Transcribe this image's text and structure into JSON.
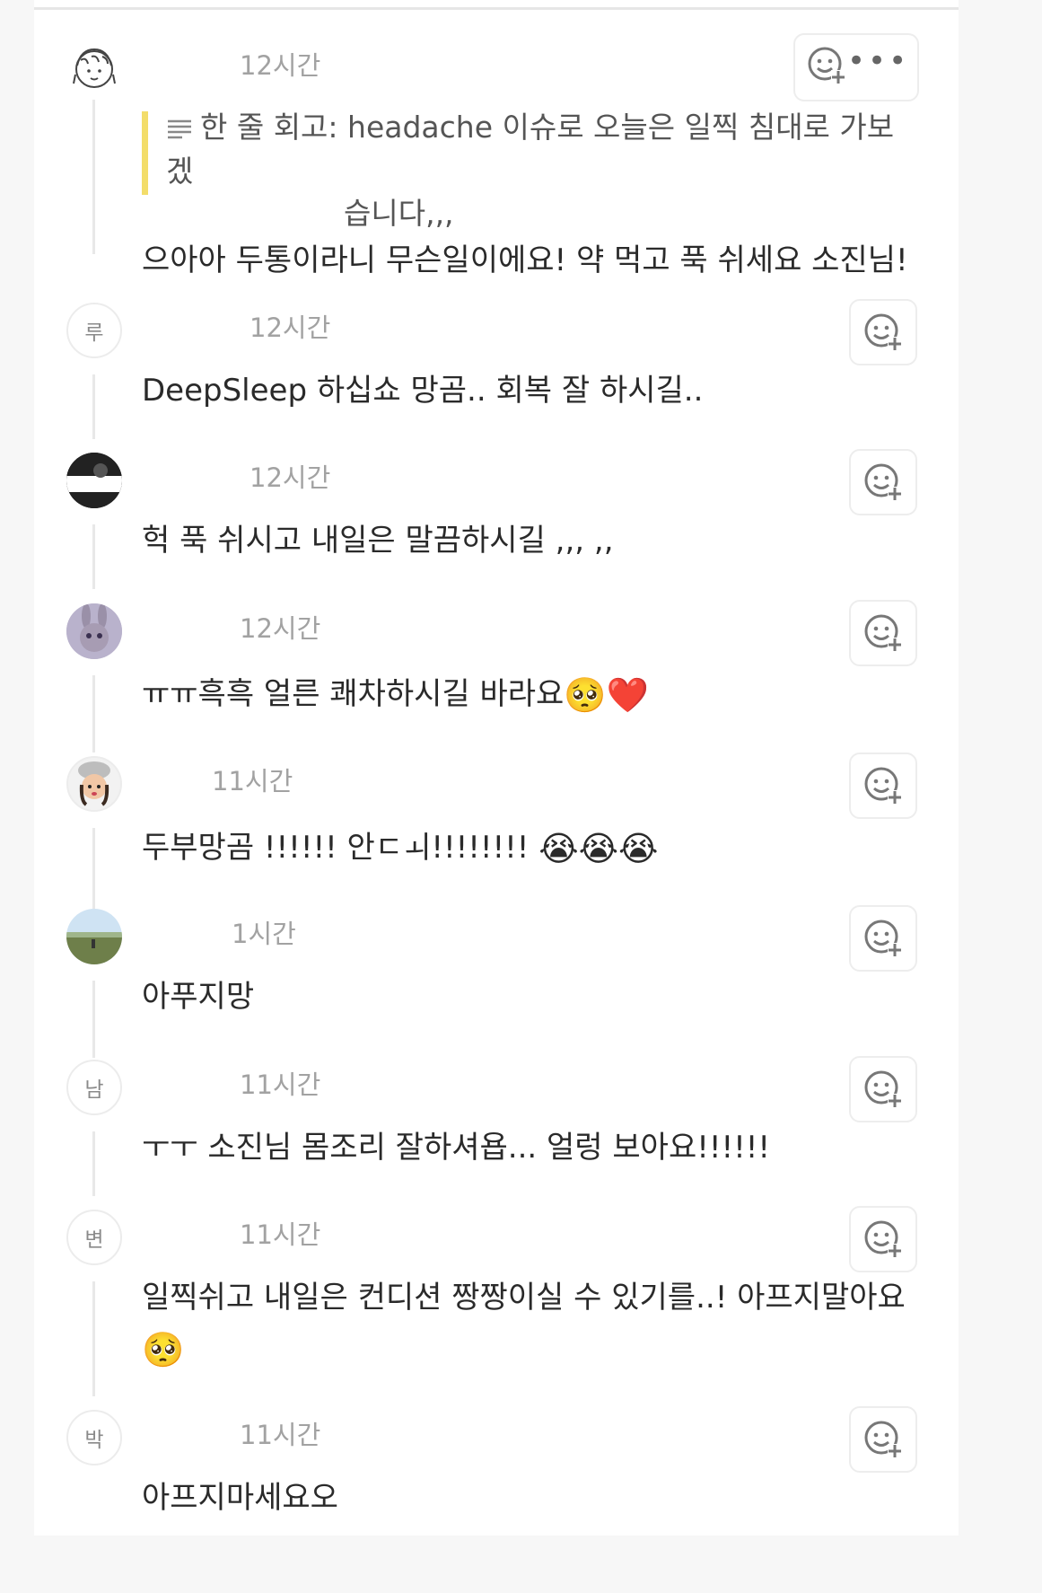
{
  "comments": [
    {
      "avatar_label": "",
      "author": "",
      "time": "12시간",
      "quote": {
        "icon": "list-icon",
        "text_line1": "한 줄 회고: headache 이슈로 오늘은 일찍 침대로 가보겠",
        "text_line2": "습니다,,,"
      },
      "text": "으아아 두통이라니 무슨일이에요! 약 먹고 푹 쉬세요 소진님!"
    },
    {
      "avatar_label": "루",
      "author": "",
      "time": "12시간",
      "text": "DeepSleep 하십쇼 망곰.. 회복 잘 하시길.."
    },
    {
      "avatar_label": "",
      "author": "",
      "time": "12시간",
      "text": "헉 푹 쉬시고 내일은 말끔하시길 ,,, ,,"
    },
    {
      "avatar_label": "",
      "author": "",
      "time": "12시간",
      "text": "ㅠㅠ흑흑 얼른 쾌차하시길 바라요",
      "emojis": [
        "🥺",
        "❤️"
      ]
    },
    {
      "avatar_label": "",
      "author": "",
      "time": "11시간",
      "text": "두부망곰 !!!!!! 안ㄷㅚ!!!!!!!!",
      "emojis": [
        "😭",
        "😭",
        "😭"
      ]
    },
    {
      "avatar_label": "",
      "author": "",
      "time": "1시간",
      "text": "아푸지망"
    },
    {
      "avatar_label": "남",
      "author": "",
      "time": "11시간",
      "text": "ㅜㅜ 소진님 몸조리 잘하셔욥... 얼렁 보아요!!!!!!"
    },
    {
      "avatar_label": "변",
      "author": "",
      "time": "11시간",
      "text": "일찍쉬고 내일은 컨디션 짱짱이실 수 있기를..! 아프지말아요",
      "emojis": [
        "🥺"
      ]
    },
    {
      "avatar_label": "박",
      "author": "",
      "time": "11시간",
      "text": "아프지마세요오"
    }
  ],
  "icons": {
    "reaction": "add-reaction-icon",
    "more": "more-options-icon"
  },
  "colors": {
    "quote_bar": "#f3dd6a",
    "timestamp": "#a2a2a2",
    "border": "#ededed"
  }
}
